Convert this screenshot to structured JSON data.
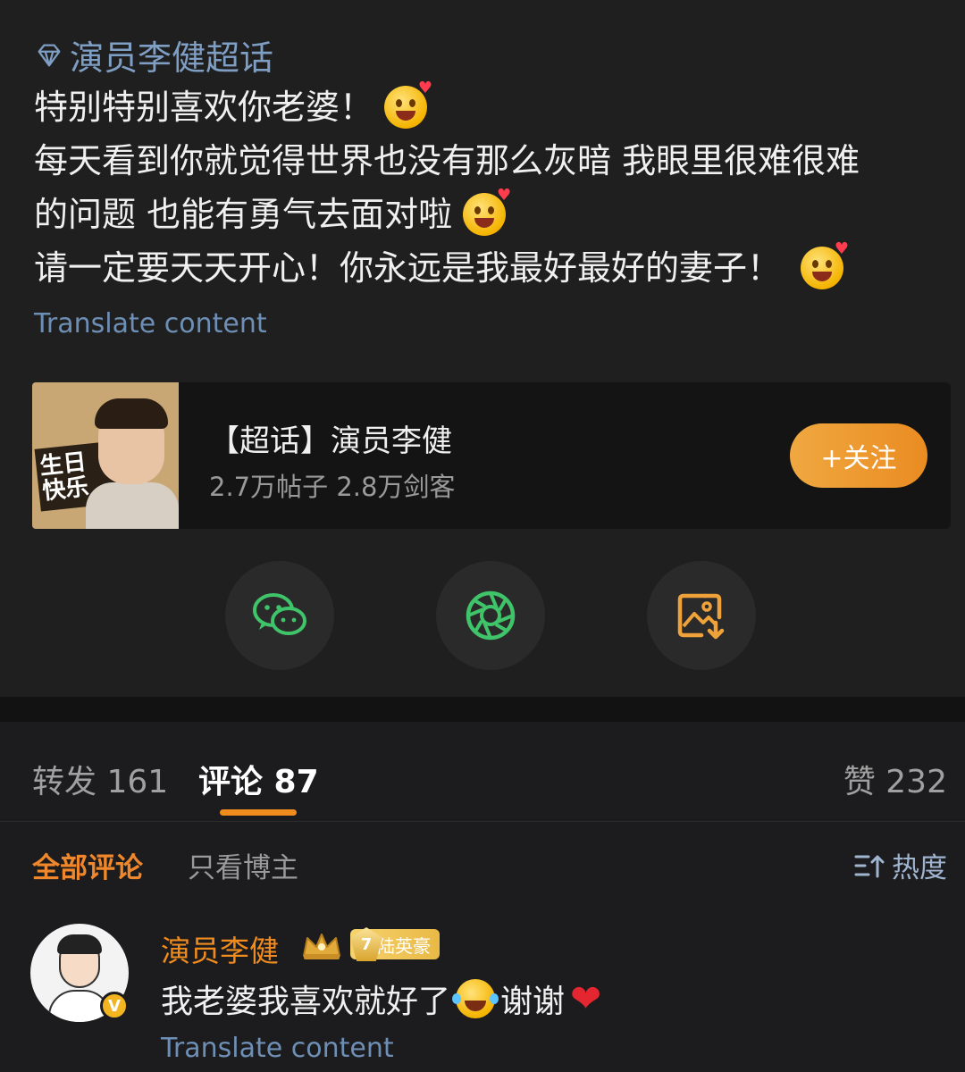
{
  "post": {
    "topic_tag": "演员李健超话",
    "lines": [
      "特别特别喜欢你老婆！",
      "每天看到你就觉得世界也没有那么灰暗 我眼里很难很难",
      "的问题 也能有勇气去面对啦",
      "请一定要天天开心！你永远是我最好最好的妻子！"
    ],
    "translate_label": "Translate content"
  },
  "topic_card": {
    "thumb_text": "生日\n快乐",
    "title": "【超话】演员李健",
    "stats": "2.7万帖子 2.8万剑客",
    "follow_label": "+关注"
  },
  "share": {
    "icons": [
      "wechat-icon",
      "moments-icon",
      "save-image-icon"
    ]
  },
  "tabs": {
    "repost": "转发 161",
    "comments": "评论 87",
    "likes": "赞 232"
  },
  "filters": {
    "all": "全部评论",
    "author_only": "只看博主",
    "sort": "热度"
  },
  "comment": {
    "author": "演员李健",
    "level": "7",
    "badge_label": "陆英豪",
    "text_1": "我老婆我喜欢就好了",
    "text_2": "谢谢",
    "verified_mark": "V",
    "translate_label": "Translate content"
  },
  "colors": {
    "accent": "#f08c1e",
    "link": "#6e8fb5",
    "background": "#1c1c1e"
  }
}
